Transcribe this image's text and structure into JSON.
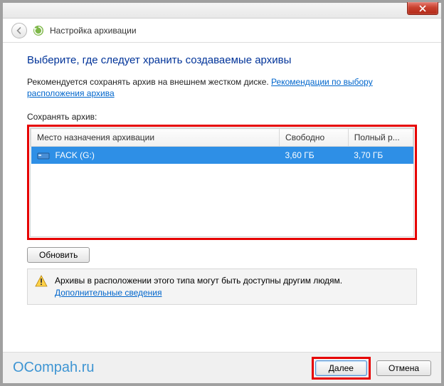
{
  "window": {
    "title": "Настройка архивации"
  },
  "heading": "Выберите, где следует хранить создаваемые архивы",
  "recommendation": {
    "text_before": "Рекомендуется сохранять архив на внешнем жестком диске. ",
    "link": "Рекомендации по выбору расположения архива"
  },
  "save_label": "Сохранять архив:",
  "table": {
    "col_dest": "Место назначения архивации",
    "col_free": "Свободно",
    "col_total": "Полный р...",
    "rows": [
      {
        "name": "FACK (G:)",
        "free": "3,60 ГБ",
        "total": "3,70 ГБ"
      }
    ]
  },
  "buttons": {
    "refresh": "Обновить",
    "next": "Далее",
    "cancel": "Отмена"
  },
  "warning": {
    "text": "Архивы в расположении этого типа могут быть доступны другим людям.",
    "link": "Дополнительные сведения"
  },
  "watermark": "OCompah.ru"
}
